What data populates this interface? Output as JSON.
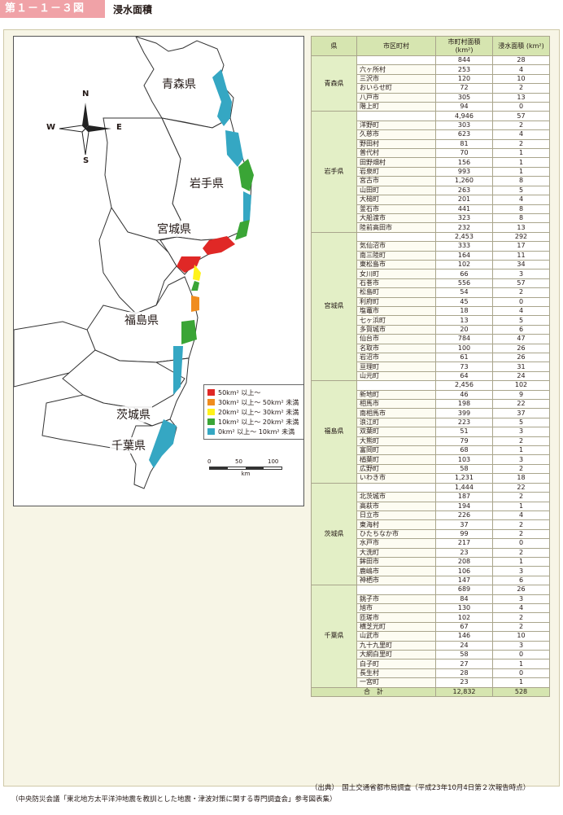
{
  "header": {
    "figure_label": "第１－１－３図",
    "title": "浸水面積"
  },
  "map": {
    "prefectures": [
      "青森県",
      "岩手県",
      "宮城県",
      "福島県",
      "茨城県",
      "千葉県"
    ],
    "compass": {
      "n": "N",
      "s": "S",
      "e": "E",
      "w": "W"
    },
    "legend": [
      {
        "label": "50km² 以上～",
        "color": "#e02826"
      },
      {
        "label": "30km² 以上～ 50km² 未満",
        "color": "#f08c1e"
      },
      {
        "label": "20km² 以上～ 30km² 未満",
        "color": "#fff21a"
      },
      {
        "label": "10km² 以上～ 20km² 未満",
        "color": "#3aa536"
      },
      {
        "label": "0km² 以上～ 10km² 未満",
        "color": "#35a7c3"
      }
    ],
    "scale": {
      "ticks": [
        "0",
        "50",
        "100"
      ],
      "unit": "km"
    },
    "colors": {
      "land": "#ffffff",
      "border": "#333333"
    }
  },
  "table": {
    "headers": {
      "pref": "県",
      "muni": "市区町村",
      "area_muni": "市町村面積 (km²)",
      "area_flood": "浸水面積 (km²)"
    },
    "prefectures": [
      {
        "name": "青森県",
        "subtotal": [
          "844",
          "28"
        ],
        "rows": [
          [
            "六ヶ所村",
            "253",
            "4"
          ],
          [
            "三沢市",
            "120",
            "10"
          ],
          [
            "おいらせ町",
            "72",
            "2"
          ],
          [
            "八戸市",
            "305",
            "13"
          ],
          [
            "階上町",
            "94",
            "0"
          ]
        ]
      },
      {
        "name": "岩手県",
        "subtotal": [
          "4,946",
          "57"
        ],
        "rows": [
          [
            "洋野町",
            "303",
            "2"
          ],
          [
            "久慈市",
            "623",
            "4"
          ],
          [
            "野田村",
            "81",
            "2"
          ],
          [
            "普代村",
            "70",
            "1"
          ],
          [
            "田野畑村",
            "156",
            "1"
          ],
          [
            "岩泉町",
            "993",
            "1"
          ],
          [
            "宮古市",
            "1,260",
            "8"
          ],
          [
            "山田町",
            "263",
            "5"
          ],
          [
            "大槌町",
            "201",
            "4"
          ],
          [
            "釜石市",
            "441",
            "8"
          ],
          [
            "大船渡市",
            "323",
            "8"
          ],
          [
            "陸前高田市",
            "232",
            "13"
          ]
        ]
      },
      {
        "name": "宮城県",
        "subtotal": [
          "2,453",
          "292"
        ],
        "rows": [
          [
            "気仙沼市",
            "333",
            "17"
          ],
          [
            "南三陸町",
            "164",
            "11"
          ],
          [
            "東松島市",
            "102",
            "34"
          ],
          [
            "女川町",
            "66",
            "3"
          ],
          [
            "石巻市",
            "556",
            "57"
          ],
          [
            "松島町",
            "54",
            "2"
          ],
          [
            "利府町",
            "45",
            "0"
          ],
          [
            "塩竈市",
            "18",
            "4"
          ],
          [
            "七ヶ浜町",
            "13",
            "5"
          ],
          [
            "多賀城市",
            "20",
            "6"
          ],
          [
            "仙台市",
            "784",
            "47"
          ],
          [
            "名取市",
            "100",
            "26"
          ],
          [
            "岩沼市",
            "61",
            "26"
          ],
          [
            "亘理町",
            "73",
            "31"
          ],
          [
            "山元町",
            "64",
            "24"
          ]
        ]
      },
      {
        "name": "福島県",
        "subtotal": [
          "2,456",
          "102"
        ],
        "rows": [
          [
            "新地町",
            "46",
            "9"
          ],
          [
            "相馬市",
            "198",
            "22"
          ],
          [
            "南相馬市",
            "399",
            "37"
          ],
          [
            "浪江町",
            "223",
            "5"
          ],
          [
            "双葉町",
            "51",
            "3"
          ],
          [
            "大熊町",
            "79",
            "2"
          ],
          [
            "富岡町",
            "68",
            "1"
          ],
          [
            "楢葉町",
            "103",
            "3"
          ],
          [
            "広野町",
            "58",
            "2"
          ],
          [
            "いわき市",
            "1,231",
            "18"
          ]
        ]
      },
      {
        "name": "茨城県",
        "subtotal": [
          "1,444",
          "22"
        ],
        "rows": [
          [
            "北茨城市",
            "187",
            "2"
          ],
          [
            "高萩市",
            "194",
            "1"
          ],
          [
            "日立市",
            "226",
            "4"
          ],
          [
            "東海村",
            "37",
            "2"
          ],
          [
            "ひたちなか市",
            "99",
            "2"
          ],
          [
            "水戸市",
            "217",
            "0"
          ],
          [
            "大洗町",
            "23",
            "2"
          ],
          [
            "鉾田市",
            "208",
            "1"
          ],
          [
            "鹿嶋市",
            "106",
            "3"
          ],
          [
            "神栖市",
            "147",
            "6"
          ]
        ]
      },
      {
        "name": "千葉県",
        "subtotal": [
          "689",
          "26"
        ],
        "rows": [
          [
            "銚子市",
            "84",
            "3"
          ],
          [
            "旭市",
            "130",
            "4"
          ],
          [
            "匝瑳市",
            "102",
            "2"
          ],
          [
            "横芝光町",
            "67",
            "2"
          ],
          [
            "山武市",
            "146",
            "10"
          ],
          [
            "九十九里町",
            "24",
            "3"
          ],
          [
            "大網白里町",
            "58",
            "0"
          ],
          [
            "白子町",
            "27",
            "1"
          ],
          [
            "長生村",
            "28",
            "0"
          ],
          [
            "一宮町",
            "23",
            "1"
          ]
        ]
      }
    ],
    "total": {
      "label": "合　計",
      "area_muni": "12,832",
      "area_flood": "528"
    }
  },
  "sources": {
    "right": "（出典）　国土交通省都市局調査（平成23年10月4日第２次報告時点）",
    "left": "（中央防災会議「東北地方太平洋沖地震を教訓とした地震・津波対策に関する専門調査会」参考図表集）"
  }
}
